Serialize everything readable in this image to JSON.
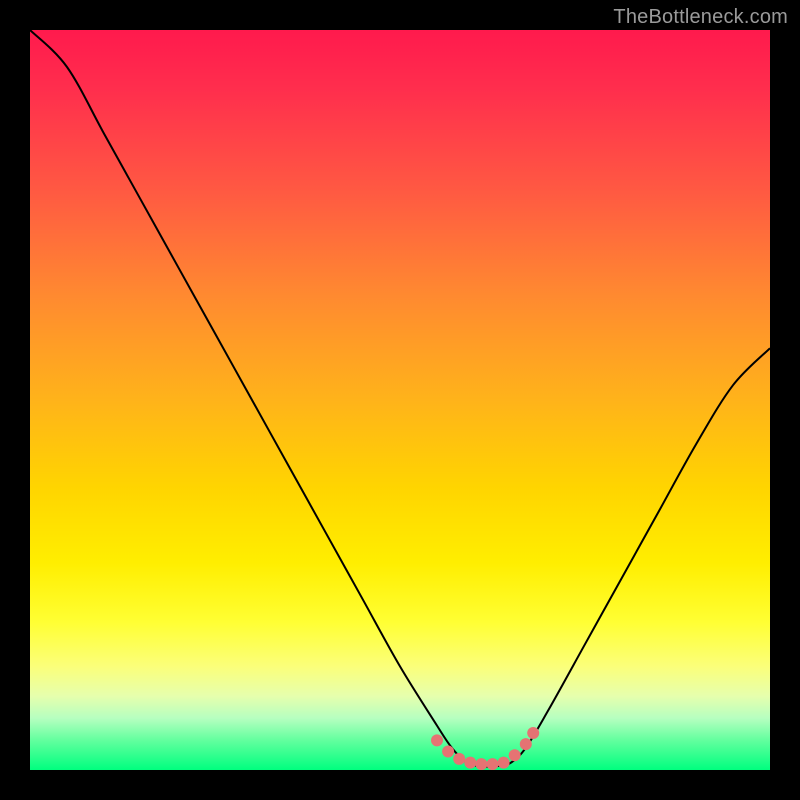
{
  "watermark": "TheBottleneck.com",
  "colors": {
    "background": "#000000",
    "gradient_top": "#ff1a4d",
    "gradient_bottom": "#00ff7f",
    "curve": "#000000",
    "marker": "#e57373"
  },
  "chart_data": {
    "type": "line",
    "title": "",
    "xlabel": "",
    "ylabel": "",
    "xlim": [
      0,
      100
    ],
    "ylim": [
      0,
      100
    ],
    "series": [
      {
        "name": "bottleneck-curve",
        "x": [
          0,
          5,
          10,
          15,
          20,
          25,
          30,
          35,
          40,
          45,
          50,
          55,
          57,
          59,
          61,
          63,
          65,
          67,
          70,
          75,
          80,
          85,
          90,
          95,
          100
        ],
        "y": [
          100,
          95,
          86,
          77,
          68,
          59,
          50,
          41,
          32,
          23,
          14,
          6,
          3,
          1,
          0.5,
          0.5,
          1,
          3,
          8,
          17,
          26,
          35,
          44,
          52,
          57
        ]
      }
    ],
    "markers": {
      "name": "highlight-dots",
      "x": [
        55,
        56.5,
        58,
        59.5,
        61,
        62.5,
        64,
        65.5,
        67,
        68
      ],
      "y": [
        4,
        2.5,
        1.5,
        1,
        0.8,
        0.8,
        1,
        2,
        3.5,
        5
      ]
    }
  }
}
